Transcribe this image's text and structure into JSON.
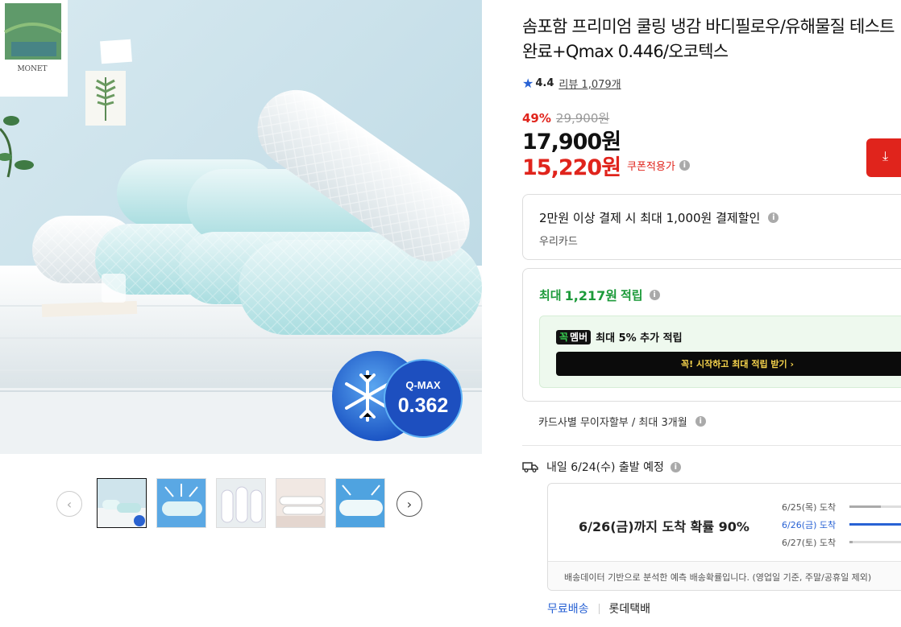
{
  "product": {
    "title": "솜포함 프리미엄 쿨링 냉감 바디필로우/유해물질 테스트완료+Qmax 0.446/오코텍스",
    "rating": "4.4",
    "review_label": "리뷰 1,079개",
    "discount_rate": "49%",
    "original_price": "29,900원",
    "sale_price": "17,900원",
    "coupon_price": "15,220원",
    "coupon_label": "쿠폰적용가"
  },
  "main_image": {
    "painting_caption": "MONET",
    "badge_label": "Q-MAX",
    "badge_value": "0.362"
  },
  "thumbnails_count": 5,
  "card_benefit": {
    "title": "2만원 이상 결제 시 최대 1,000원 결제할인",
    "card_name": "우리카드"
  },
  "points": {
    "prefix": "최대",
    "amount": "1,217원",
    "suffix": "적립",
    "member_badge_g": "꼭",
    "member_badge": "멤버",
    "member_text": "최대 5% 추가 적립",
    "member_button": "꼭! 시작하고 최대 적립 받기 ›"
  },
  "installment": "카드사별 무이자할부 / 최대 3개월",
  "shipping": {
    "departure": "내일 6/24(수) 출발 예정",
    "probability": "6/26(금)까지 도착 확률 90%",
    "dates": [
      {
        "label": "6/25(목) 도착",
        "share": 0.45
      },
      {
        "label": "6/26(금) 도착",
        "share": 1.0
      },
      {
        "label": "6/27(토) 도착",
        "share": 0.05
      }
    ],
    "note": "배송데이터 기반으로 분석한 예측 배송확률입니다. (영업일 기준, 주말/공휴일 제외)",
    "free_label": "무료배송",
    "carrier": "롯데택배"
  },
  "colors": {
    "accent_red": "#e0241c",
    "accent_blue": "#2862d4",
    "point_green": "#1c9a3a"
  }
}
